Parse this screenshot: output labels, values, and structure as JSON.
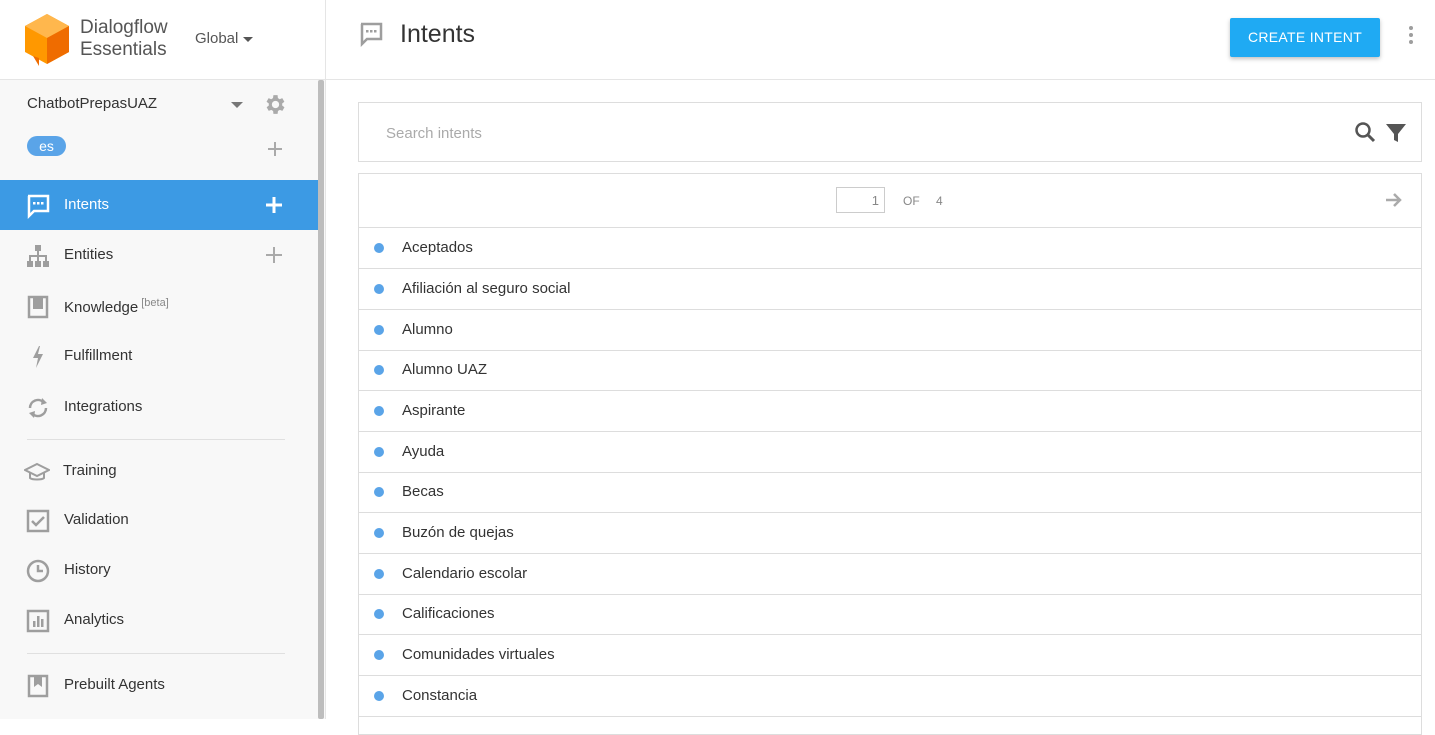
{
  "brand": {
    "line1": "Dialogflow",
    "line2": "Essentials",
    "region": "Global"
  },
  "agent": {
    "name": "ChatbotPrepasUAZ",
    "language": "es"
  },
  "sidebar": {
    "items": [
      {
        "label": "Intents",
        "icon": "chat-bubble-icon"
      },
      {
        "label": "Entities",
        "icon": "hierarchy-icon"
      },
      {
        "label": "Knowledge",
        "badge": "[beta]",
        "icon": "book-icon"
      },
      {
        "label": "Fulfillment",
        "icon": "lightning-icon"
      },
      {
        "label": "Integrations",
        "icon": "sync-icon"
      },
      {
        "label": "Training",
        "icon": "graduation-cap-icon"
      },
      {
        "label": "Validation",
        "icon": "checkbox-icon"
      },
      {
        "label": "History",
        "icon": "clock-icon"
      },
      {
        "label": "Analytics",
        "icon": "bar-chart-icon"
      },
      {
        "label": "Prebuilt Agents",
        "icon": "bookmark-book-icon"
      }
    ]
  },
  "header": {
    "title": "Intents",
    "create_label": "CREATE INTENT"
  },
  "search": {
    "placeholder": "Search intents"
  },
  "pagination": {
    "current": "1",
    "of_label": "OF",
    "total": "4"
  },
  "intents": [
    "Aceptados",
    "Afiliación al seguro social",
    "Alumno",
    "Alumno UAZ",
    "Aspirante",
    "Ayuda",
    "Becas",
    "Buzón de quejas",
    "Calendario escolar",
    "Calificaciones",
    "Comunidades virtuales",
    "Constancia"
  ],
  "colors": {
    "accent": "#3c9ae4",
    "button": "#1faaf3",
    "dot": "#5aa4e8",
    "logo": "#f57c00"
  }
}
